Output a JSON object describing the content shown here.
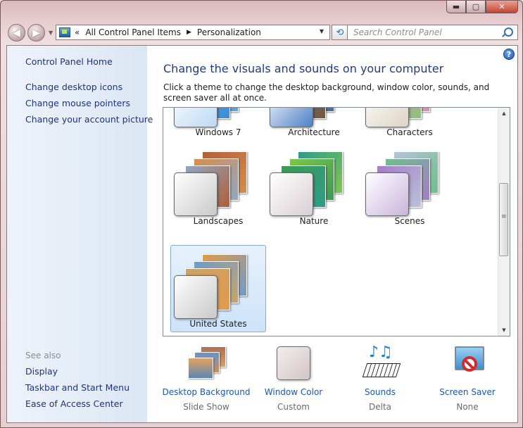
{
  "window": {
    "minimize": "▬",
    "maximize": "▢",
    "close": "✕"
  },
  "nav": {
    "back": "◀",
    "forward": "▶",
    "dropdown": "▼",
    "refresh": "⟲"
  },
  "address": {
    "overflow": "«",
    "crumbs": [
      "All Control Panel Items",
      "Personalization"
    ],
    "separator": "▶",
    "dropdown": "▼"
  },
  "search": {
    "placeholder": "Search Control Panel"
  },
  "sidebar": {
    "home": "Control Panel Home",
    "links": [
      "Change desktop icons",
      "Change mouse pointers",
      "Change your account picture"
    ],
    "see_also_label": "See also",
    "see_also": [
      "Display",
      "Taskbar and Start Menu",
      "Ease of Access Center"
    ]
  },
  "main": {
    "help": "?",
    "heading": "Change the visuals and sounds on your computer",
    "description": "Click a theme to change the desktop background, window color, sounds, and screen saver all at once."
  },
  "themes": [
    {
      "name": "Windows 7",
      "colors": [
        "#3c8dd8",
        "#2a73c4",
        "#5aa7e8"
      ],
      "swatch": "#bcd9f5",
      "selected": false
    },
    {
      "name": "Architecture",
      "colors": [
        "#7a5a3a",
        "#c49a58",
        "#3c6fb2"
      ],
      "swatch": "#4d7fc9",
      "selected": false
    },
    {
      "name": "Characters",
      "colors": [
        "#8cc37a",
        "#e3b46a",
        "#d98fb1"
      ],
      "swatch": "#ddd4c2",
      "selected": false
    },
    {
      "name": "Landscapes",
      "colors": [
        "#b05e3a",
        "#d98d4c",
        "#8fa7c4"
      ],
      "swatch": "#c9c9c9",
      "selected": false
    },
    {
      "name": "Nature",
      "colors": [
        "#2f9c8a",
        "#7cc74a",
        "#3c9a56"
      ],
      "swatch": "#d8cfd3",
      "selected": false
    },
    {
      "name": "Scenes",
      "colors": [
        "#b8c2d8",
        "#6dbf8e",
        "#a57cc9"
      ],
      "swatch": "#c9b4dd",
      "selected": false
    },
    {
      "name": "United States",
      "colors": [
        "#e39a4c",
        "#6e9bc9",
        "#c8a46a"
      ],
      "swatch": "#c9c9c9",
      "selected": true
    }
  ],
  "bottom": [
    {
      "label": "Desktop Background",
      "sub": "Slide Show"
    },
    {
      "label": "Window Color",
      "sub": "Custom"
    },
    {
      "label": "Sounds",
      "sub": "Delta"
    },
    {
      "label": "Screen Saver",
      "sub": "None"
    }
  ],
  "scroll": {
    "up": "▲",
    "down": "▼"
  }
}
